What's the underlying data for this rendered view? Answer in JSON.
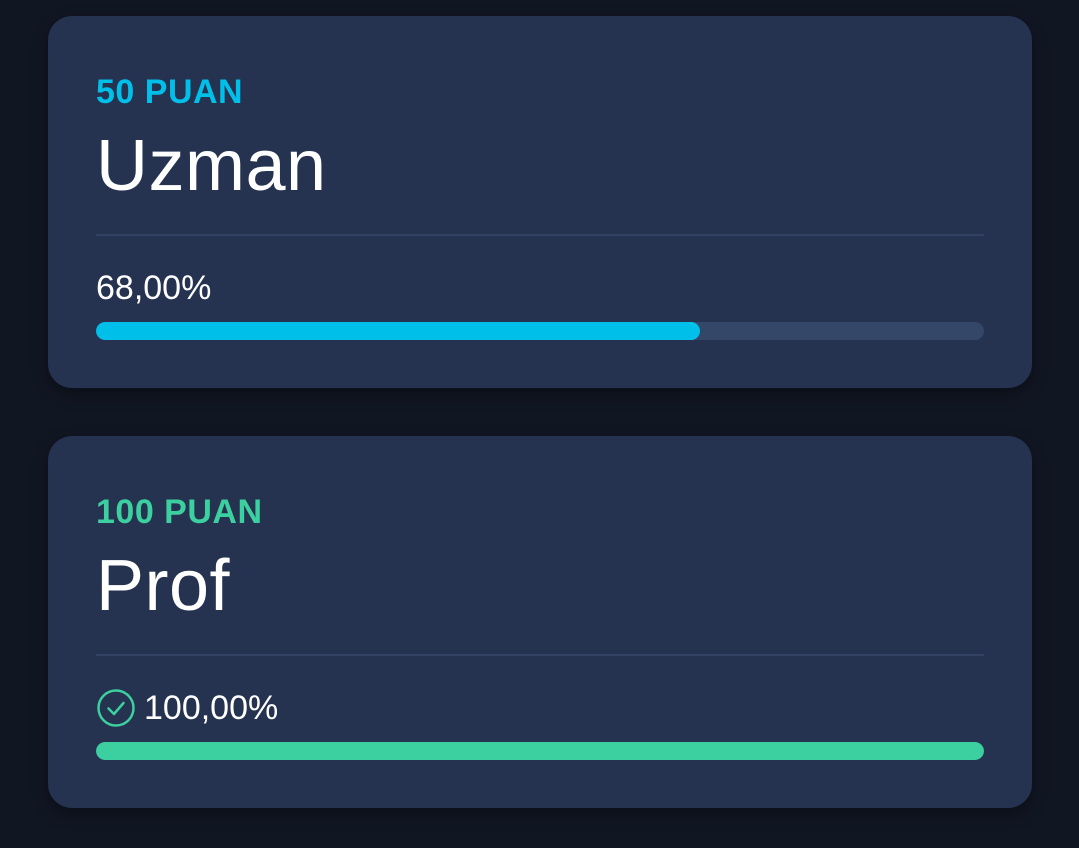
{
  "levels": [
    {
      "points_label": "50 PUAN",
      "name": "Uzman",
      "percent_label": "68,00%",
      "progress": 0.68,
      "completed": false,
      "accent_color": "#00bfe8"
    },
    {
      "points_label": "100 PUAN",
      "name": "Prof",
      "percent_label": "100,00%",
      "progress": 1.0,
      "completed": true,
      "accent_color": "#3ccfa0",
      "status_icon": "check-circle-icon"
    }
  ],
  "colors": {
    "background": "#111623",
    "card": "#253250",
    "track": "#354769",
    "text": "#ffffff"
  }
}
